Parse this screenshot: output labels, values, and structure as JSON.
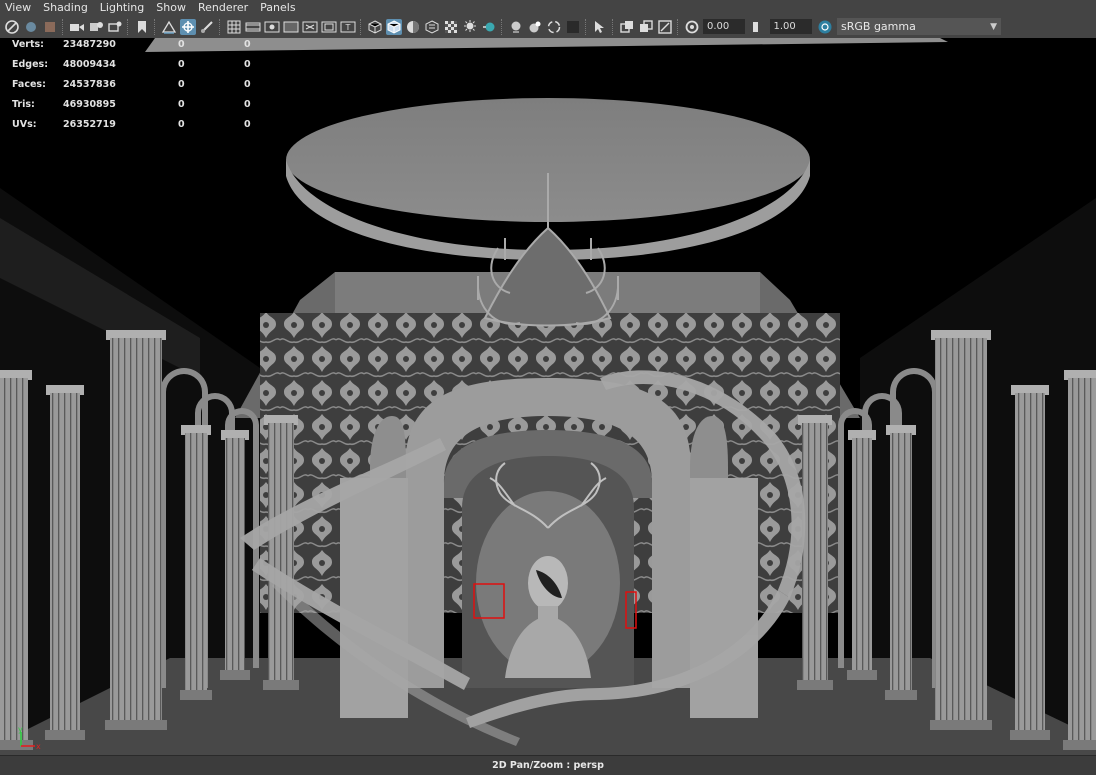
{
  "menu": [
    "View",
    "Shading",
    "Lighting",
    "Show",
    "Renderer",
    "Panels"
  ],
  "toolbar": {
    "exposure_value": "0.00",
    "gamma_value": "1.00",
    "color_space": "sRGB gamma",
    "icons": [
      "camera-select-icon",
      "camera-attributes-icon",
      "bookmarks-icon",
      "image-plane-icon",
      "2d-pan-zoom-icon",
      "grease-pencil-icon",
      "grid-icon",
      "film-gate-icon",
      "resolution-gate-icon",
      "gate-mask-icon",
      "field-chart-icon",
      "safe-action-icon",
      "safe-title-icon",
      "wireframe-icon",
      "smooth-shade-icon",
      "wireframe-on-shaded-icon",
      "textured-icon",
      "use-all-lights-icon",
      "shadows-icon",
      "screen-space-ao-icon",
      "motion-blur-icon",
      "multisample-aa-icon",
      "depth-of-field-icon",
      "isolate-select-icon",
      "xray-icon",
      "xray-joints-icon",
      "xray-components-icon",
      "exposure-icon",
      "gamma-icon",
      "color-management-icon"
    ]
  },
  "hud": {
    "rows": [
      {
        "label": "Verts:",
        "v1": "23487290",
        "v2": "0",
        "v3": "0"
      },
      {
        "label": "Edges:",
        "v1": "48009434",
        "v2": "0",
        "v3": "0"
      },
      {
        "label": "Faces:",
        "v1": "24537836",
        "v2": "0",
        "v3": "0"
      },
      {
        "label": "Tris:",
        "v1": "46930895",
        "v2": "0",
        "v3": "0"
      },
      {
        "label": "UVs:",
        "v1": "26352719",
        "v2": "0",
        "v3": "0"
      }
    ]
  },
  "axis": {
    "y_label": "y",
    "x_label": "x"
  },
  "status": {
    "text": "2D Pan/Zoom : persp"
  },
  "colors": {
    "ui_bg": "#444444",
    "viewport_bg": "#000000",
    "geometry": "#8a8a8a",
    "selection": "#e01010",
    "accent": "#5e8fb0"
  }
}
